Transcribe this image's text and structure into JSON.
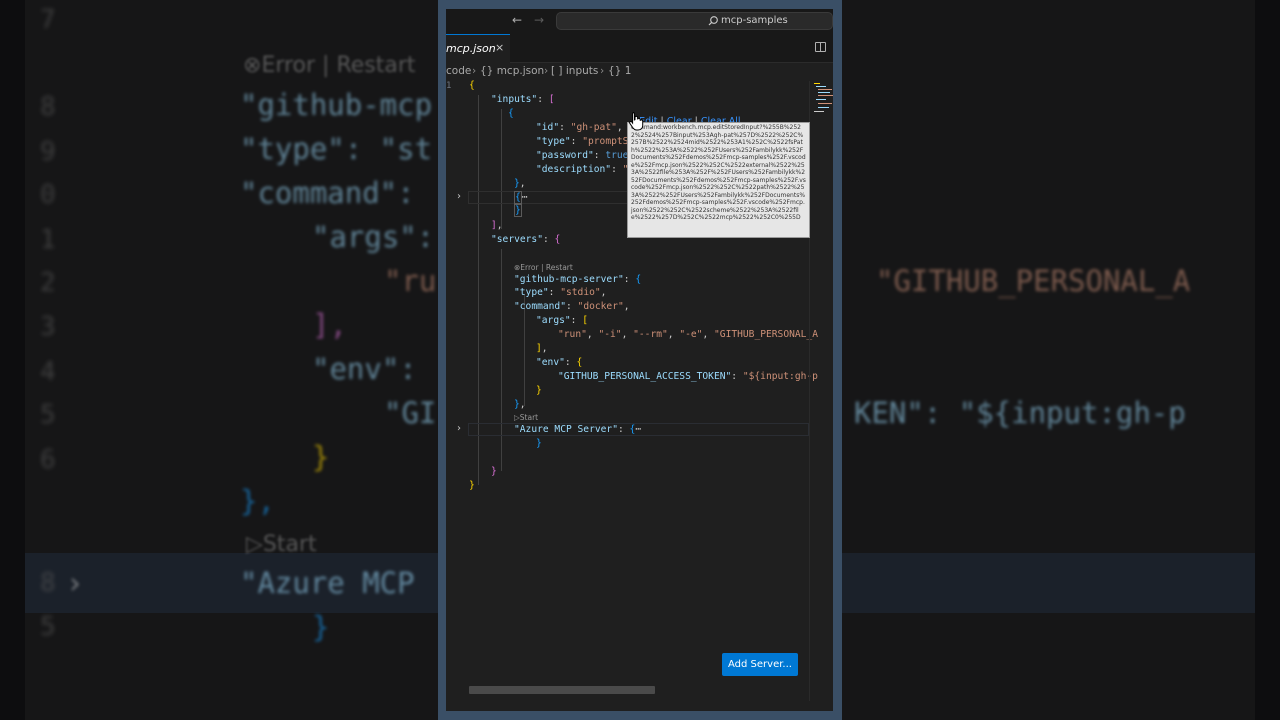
{
  "window": {
    "search_text": "mcp-samples",
    "back_icon": "arrow-left-icon",
    "forward_icon": "arrow-right-icon"
  },
  "tab": {
    "label": "mcp.json",
    "close": "×"
  },
  "breadcrumbs": [
    "code",
    "{} mcp.json",
    "[ ] inputs",
    "{} 1"
  ],
  "codelens": {
    "error_restart": "Error | Restart",
    "start": "Start"
  },
  "hover_actions": {
    "edit": "Edit",
    "clear": "Clear",
    "clear_all": "Clear All"
  },
  "tooltip_text": "command:workbench.mcp.editStoredInput?%255B%2522%2524%257Binput%253Agh-pat%257D%2522%252C%257B%2522%2524mid%2522%253A1%252C%2522fsPath%2522%253A%2522%252FUsers%252Fambilykk%252FDocuments%252Fdemos%252Fmcp-samples%252F.vscode%252Fmcp.json%2522%252C%2522external%2522%253A%2522file%253A%252F%252FUsers%252Fambilykk%252FDocuments%252Fdemos%252Fmcp-samples%252F.vscode%252Fmcp.json%2522%252C%2522path%2522%253A%2522%252FUsers%252Fambilykk%252FDocuments%252Fdemos%252Fmcp-samples%252F.vscode%252Fmcp.json%2522%252C%2522scheme%2522%253A%2522file%2522%257D%252C%2522mcp%2522%252C0%255D",
  "code": {
    "l1": "{",
    "inputs_key": "\"inputs\"",
    "id_key": "\"id\"",
    "id_val": "\"gh-pat\"",
    "type_key": "\"type\"",
    "type_val": "\"promptString\"",
    "password_key": "\"password\"",
    "password_val": "true",
    "description_key": "\"description\"",
    "description_val": "\"",
    "servers_key": "\"servers\"",
    "server_name": "\"github-mcp-server\"",
    "stype_key": "\"type\"",
    "stype_val": "\"stdio\"",
    "command_key": "\"command\"",
    "command_val": "\"docker\"",
    "args_key": "\"args\"",
    "args_vals": [
      "\"run\"",
      "\"-i\"",
      "\"--rm\"",
      "\"-e\"",
      "\"GITHUB_PERSONAL_A"
    ],
    "env_key": "\"env\"",
    "env_token_key": "\"GITHUB_PERSONAL_ACCESS_TOKEN\"",
    "env_token_val": "\"${input:gh-p",
    "azure_key": "\"Azure MCP Server\""
  },
  "add_server_label": "Add Server...",
  "background": {
    "error_restart": "Error | Restart",
    "start": "Start",
    "lines": [
      "\"github-mcp",
      "\"type\": \"st",
      "\"command\":",
      "\"args\":",
      "\"ru",
      "],",
      "\"env\":",
      "\"GI",
      "}",
      "},",
      "\"Azure MCP",
      "}",
      "\"GITHUB_PERSONAL_A",
      "KEN\": \"${input:gh-p"
    ],
    "line_numbers": [
      "7",
      "8",
      "9",
      "0",
      "1",
      "2",
      "3",
      "4",
      "5",
      "6",
      "8",
      "5"
    ]
  },
  "colors": {
    "accent": "#0078d4",
    "editor_bg": "#1f1f1f",
    "key": "#9cdcfe",
    "string": "#ce9178",
    "keyword": "#569cd6",
    "window_frame": "#3a4f66"
  }
}
